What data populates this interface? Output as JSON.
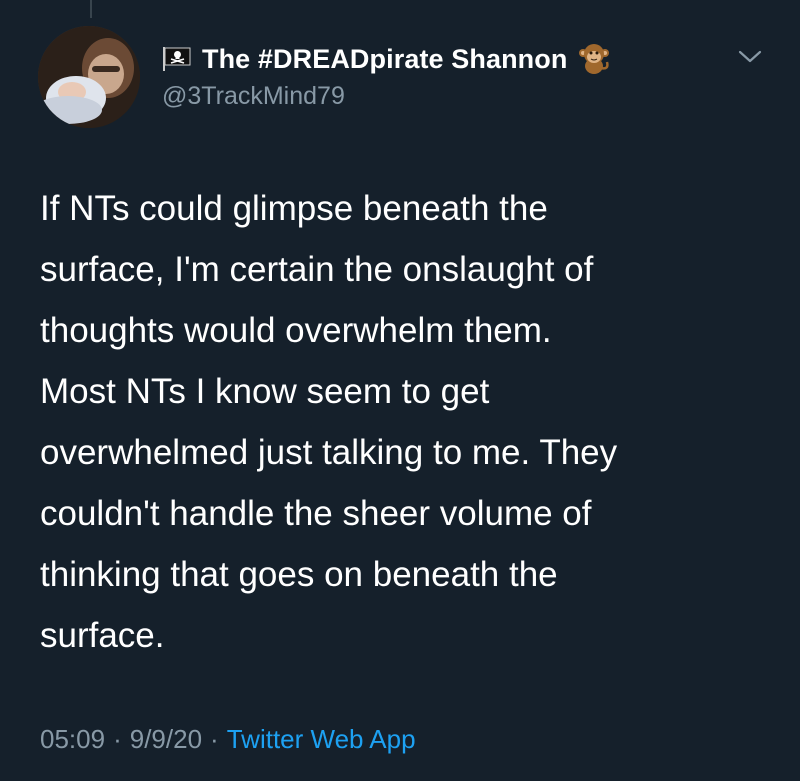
{
  "author": {
    "display_name": "The #DREADpirate Shannon",
    "handle": "@3TrackMind79",
    "name_prefix_icon": "pirate-flag-icon",
    "name_suffix_icon": "monkey-emoji-icon"
  },
  "tweet": {
    "text": "If NTs could glimpse beneath the\nsurface, I'm certain the onslaught of\nthoughts would overwhelm them.\nMost NTs I know seem to get\noverwhelmed just talking to me. They\ncouldn't handle the sheer volume of\nthinking that goes on beneath the\nsurface.",
    "time": "05:09",
    "date": "9/9/20",
    "separator": "·",
    "source": "Twitter Web App"
  },
  "colors": {
    "background": "#15202b",
    "primary_text": "#ffffff",
    "secondary_text": "#8899a6",
    "link": "#1da1f2"
  },
  "icons": {
    "menu": "chevron-down-icon",
    "avatar": "avatar"
  }
}
